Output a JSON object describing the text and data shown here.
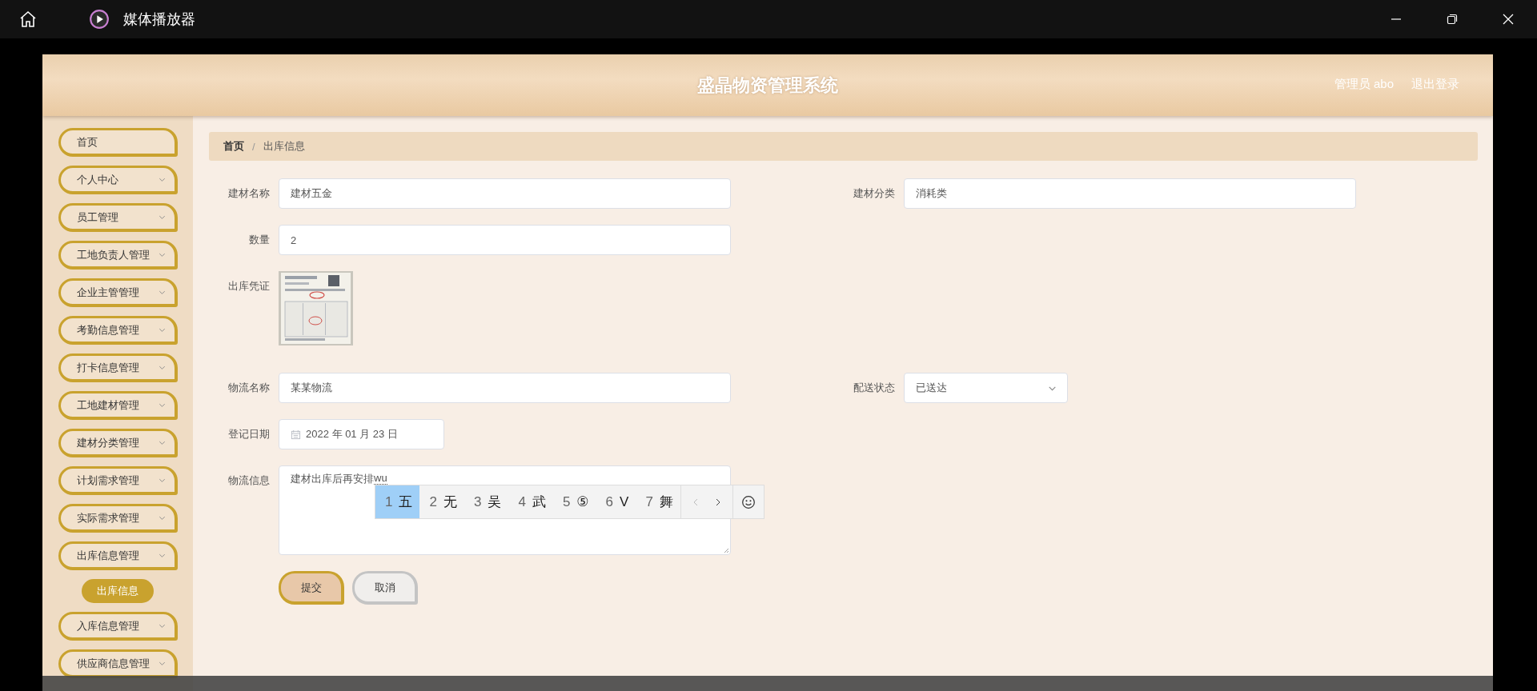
{
  "window": {
    "title": "媒体播放器"
  },
  "header": {
    "title": "盛晶物资管理系统",
    "user": "管理员 abo",
    "logout": "退出登录"
  },
  "sidebar": {
    "items": [
      {
        "label": "首页",
        "kind": "link"
      },
      {
        "label": "个人中心",
        "kind": "submenu"
      },
      {
        "label": "员工管理",
        "kind": "submenu"
      },
      {
        "label": "工地负责人管理",
        "kind": "submenu"
      },
      {
        "label": "企业主管管理",
        "kind": "submenu"
      },
      {
        "label": "考勤信息管理",
        "kind": "submenu"
      },
      {
        "label": "打卡信息管理",
        "kind": "submenu"
      },
      {
        "label": "工地建材管理",
        "kind": "submenu"
      },
      {
        "label": "建材分类管理",
        "kind": "submenu"
      },
      {
        "label": "计划需求管理",
        "kind": "submenu"
      },
      {
        "label": "实际需求管理",
        "kind": "submenu"
      },
      {
        "label": "出库信息管理",
        "kind": "submenu",
        "children": [
          {
            "label": "出库信息",
            "selected": true
          }
        ]
      },
      {
        "label": "入库信息管理",
        "kind": "submenu"
      },
      {
        "label": "供应商信息管理",
        "kind": "submenu"
      }
    ]
  },
  "breadcrumb": [
    "首页",
    "出库信息"
  ],
  "breadcrumb_separator": "/",
  "form": {
    "rows": [
      [
        {
          "label": "建材名称",
          "kind": "text",
          "value": "建材五金"
        },
        {
          "label": "建材分类",
          "kind": "text",
          "value": "消耗类"
        }
      ],
      [
        {
          "label": "数量",
          "kind": "text",
          "value": "2"
        }
      ],
      [
        {
          "label": "出库凭证"
        }
      ],
      [
        {
          "label": "物流名称",
          "kind": "text",
          "value": "某某物流"
        },
        {
          "label": "配送状态",
          "kind": "select",
          "value": "已送达"
        }
      ],
      [
        {
          "label": "登记日期",
          "kind": "date",
          "value": "2022 年 01 月 23 日"
        }
      ],
      [
        {
          "label": "物流信息",
          "kind": "textarea",
          "value": "建材出库后再安排",
          "composition": "wu"
        }
      ]
    ],
    "buttons": [
      {
        "label": "提交",
        "kind": "primary"
      },
      {
        "label": "取消",
        "kind": "secondary"
      }
    ]
  },
  "ime": {
    "candidates": [
      {
        "index": "1",
        "text": "五",
        "selected": true
      },
      {
        "index": "2",
        "text": "无",
        "selected": false
      },
      {
        "index": "3",
        "text": "吴",
        "selected": false
      },
      {
        "index": "4",
        "text": "武",
        "selected": false
      },
      {
        "index": "5",
        "text": "⑤",
        "selected": false
      },
      {
        "index": "6",
        "text": "V",
        "selected": false
      },
      {
        "index": "7",
        "text": "舞",
        "selected": false
      }
    ]
  }
}
